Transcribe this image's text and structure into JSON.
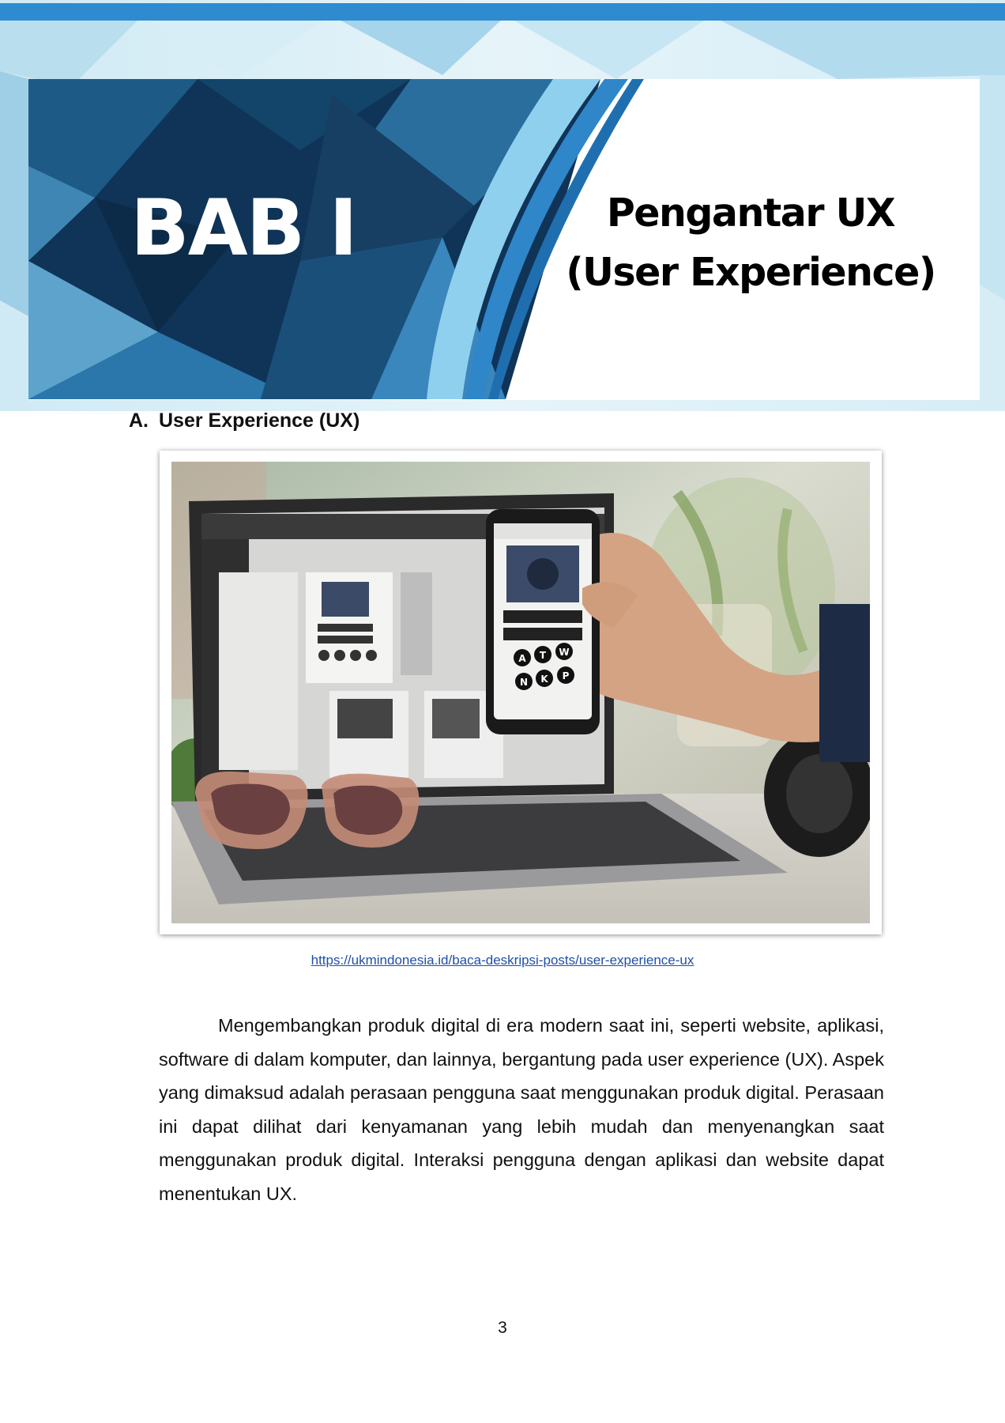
{
  "chapter": {
    "label": "BAB I",
    "title_line1": "Pengantar UX",
    "title_line2": "(User Experience)"
  },
  "section": {
    "letter": "A.",
    "heading": "User Experience (UX)"
  },
  "figure": {
    "source_url": "https://ukmindonesia.id/baca-deskripsi-posts/user-experience-ux",
    "phone_buttons": [
      "A",
      "T",
      "W",
      "N",
      "K",
      "P"
    ]
  },
  "body": {
    "paragraph": "Mengembangkan produk digital di era modern saat ini, seperti website, aplikasi, software di dalam komputer, dan lainnya, bergantung pada user experience (UX). Aspek yang dimaksud adalah perasaan pengguna saat menggunakan produk digital. Perasaan ini dapat dilihat dari kenyamanan yang lebih mudah dan menyenangkan saat menggunakan produk digital. Interaksi pengguna dengan aplikasi dan website dapat menentukan UX."
  },
  "footer": {
    "page_number": "3"
  },
  "colors": {
    "banner_dark": "#0f3457",
    "banner_accent": "#2f86c9",
    "banner_light": "#8ecbe6",
    "link": "#1f4fa8"
  }
}
